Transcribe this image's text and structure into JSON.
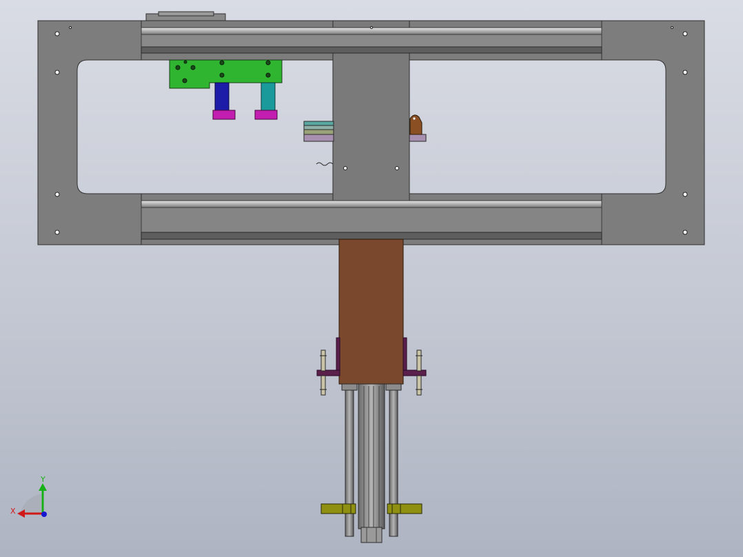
{
  "viewport": {
    "background_top": "#d9dce4",
    "background_bottom": "#aeb4c2"
  },
  "colors": {
    "plate": "#7d7d7d",
    "plate_edge": "#2f2f2f",
    "rail": "#b9b9b9",
    "green_block": "#2fb52f",
    "blue_cylinder": "#1c1ca8",
    "teal_cylinder": "#1a9a9a",
    "magenta_pad": "#c21fb0",
    "brown_block": "#7a482c",
    "purple_bracket": "#5a1f4a",
    "olive_clamp": "#8f8f12",
    "axis_x": "#d01818",
    "axis_y": "#18b018",
    "axis_z": "#1818d0"
  },
  "triad": {
    "x_label": "X",
    "y_label": "Y"
  }
}
